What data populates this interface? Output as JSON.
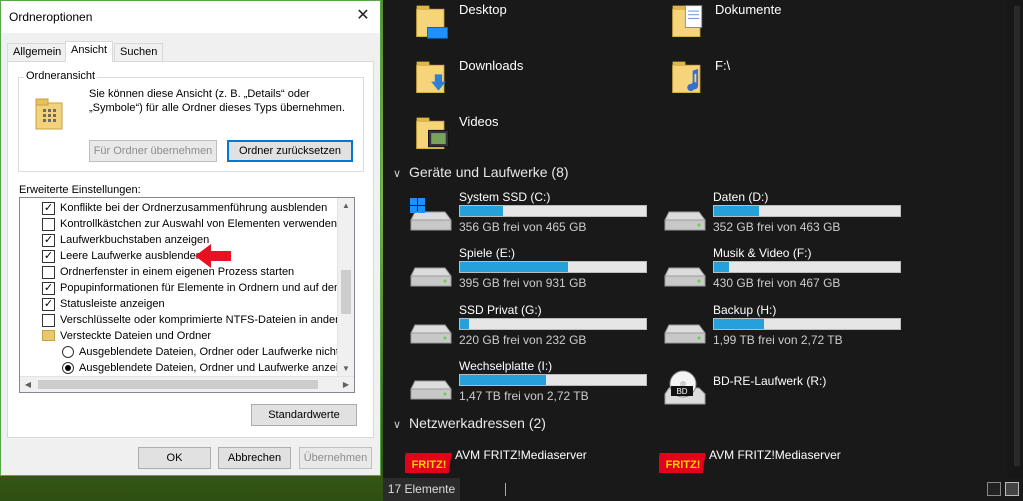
{
  "dialog": {
    "title": "Ordneroptionen",
    "close_icon": "close-icon",
    "tabs": [
      {
        "label": "Allgemein"
      },
      {
        "label": "Ansicht"
      },
      {
        "label": "Suchen"
      }
    ],
    "folder_view": {
      "legend": "Ordneransicht",
      "description": "Sie können diese Ansicht (z. B. „Details“ oder „Symbole“) für alle Ordner dieses Typs übernehmen.",
      "apply_button": "Für Ordner übernehmen",
      "reset_button": "Ordner zurücksetzen"
    },
    "advanced_label": "Erweiterte Einstellungen:",
    "settings": [
      {
        "type": "checkbox",
        "checked": true,
        "label": "Konflikte bei der Ordnerzusammenführung ausblenden"
      },
      {
        "type": "checkbox",
        "checked": false,
        "label": "Kontrollkästchen zur Auswahl von Elementen verwenden"
      },
      {
        "type": "checkbox",
        "checked": true,
        "label": "Laufwerkbuchstaben anzeigen"
      },
      {
        "type": "checkbox",
        "checked": true,
        "label": "Leere Laufwerke ausblenden"
      },
      {
        "type": "checkbox",
        "checked": false,
        "label": "Ordnerfenster in einem eigenen Prozess starten"
      },
      {
        "type": "checkbox",
        "checked": true,
        "label": "Popupinformationen für Elemente in Ordnern und auf dem D"
      },
      {
        "type": "checkbox",
        "checked": true,
        "label": "Statusleiste anzeigen"
      },
      {
        "type": "checkbox",
        "checked": false,
        "label": "Verschlüsselte oder komprimierte NTFS-Dateien in anderer"
      },
      {
        "type": "folder",
        "label": "Versteckte Dateien und Ordner"
      },
      {
        "type": "radio",
        "checked": false,
        "label": "Ausgeblendete Dateien, Ordner oder Laufwerke nicht a"
      },
      {
        "type": "radio",
        "checked": true,
        "label": "Ausgeblendete Dateien, Ordner und Laufwerke anzeige"
      }
    ],
    "defaults_button": "Standardwerte",
    "ok_button": "OK",
    "cancel_button": "Abbrechen",
    "apply_button": "Übernehmen",
    "arrow_color": "#e81123"
  },
  "explorer": {
    "folders": [
      {
        "name": "Desktop",
        "icon": "desktop-folder-icon"
      },
      {
        "name": "Dokumente",
        "icon": "documents-folder-icon"
      },
      {
        "name": "Downloads",
        "icon": "downloads-folder-icon"
      },
      {
        "name": "F:\\",
        "icon": "music-folder-icon"
      },
      {
        "name": "Videos",
        "icon": "videos-folder-icon"
      }
    ],
    "drives_header": "Geräte und Laufwerke (8)",
    "drives": [
      {
        "name": "System SSD (C:)",
        "free": "356 GB frei von 465 GB",
        "used_fraction": 0.23,
        "icon": "windows-drive-icon"
      },
      {
        "name": "Daten (D:)",
        "free": "352 GB frei von 463 GB",
        "used_fraction": 0.24,
        "icon": "hard-drive-icon"
      },
      {
        "name": "Spiele (E:)",
        "free": "395 GB frei von 931 GB",
        "used_fraction": 0.58,
        "icon": "hard-drive-icon"
      },
      {
        "name": "Musik & Video (F:)",
        "free": "430 GB frei von 467 GB",
        "used_fraction": 0.08,
        "icon": "hard-drive-icon"
      },
      {
        "name": "SSD Privat (G:)",
        "free": "220 GB frei von 232 GB",
        "used_fraction": 0.05,
        "icon": "hard-drive-icon"
      },
      {
        "name": "Backup (H:)",
        "free": "1,99 TB frei von 2,72 TB",
        "used_fraction": 0.27,
        "icon": "hard-drive-icon"
      },
      {
        "name": "Wechselplatte (I:)",
        "free": "1,47 TB frei von 2,72 TB",
        "used_fraction": 0.46,
        "icon": "hard-drive-icon"
      },
      {
        "name": "BD-RE-Laufwerk (R:)",
        "free": "",
        "icon": "bd-drive-icon",
        "badge": "BD"
      }
    ],
    "network_header": "Netzwerkadressen (2)",
    "network": [
      {
        "name": "AVM FRITZ!Mediaserver",
        "icon": "fritz-icon",
        "logo": "FRITZ!"
      },
      {
        "name": "AVM FRITZ!Mediaserver",
        "icon": "fritz-icon",
        "logo": "FRITZ!"
      }
    ],
    "status": {
      "count": "17 Elemente"
    }
  }
}
